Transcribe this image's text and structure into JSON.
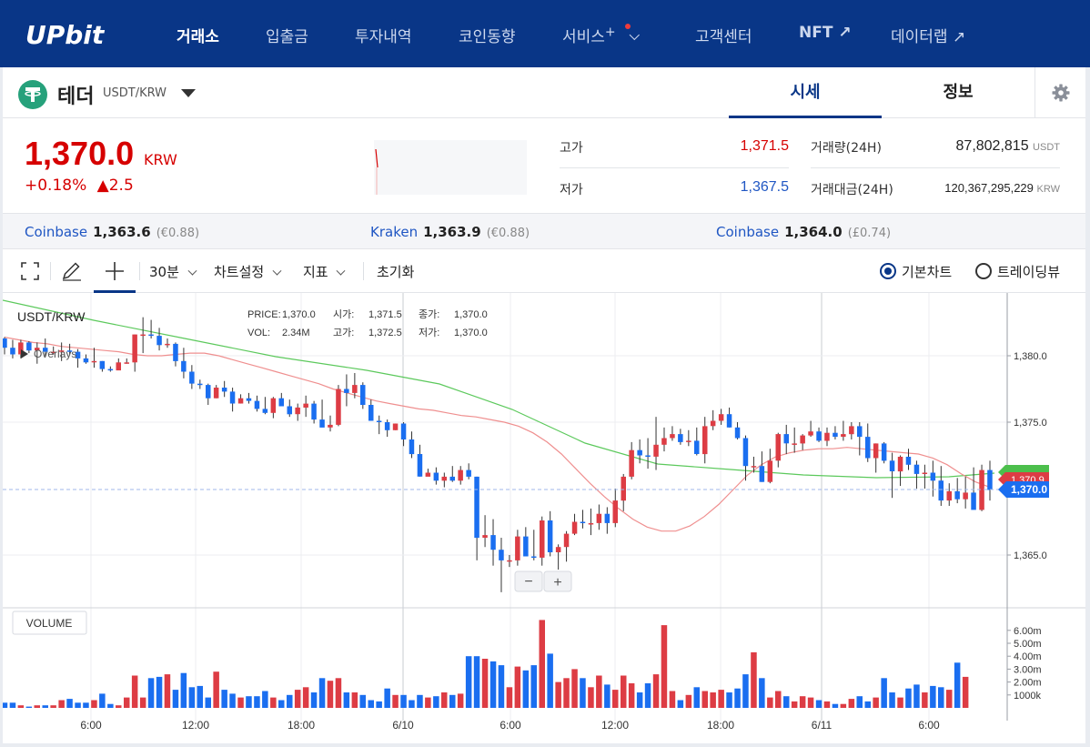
{
  "nav": {
    "logo": "UPbit",
    "items": [
      "거래소",
      "입출금",
      "투자내역",
      "코인동향",
      "서비스",
      "고객센터",
      "NFT ↗",
      "데이터랩 ↗"
    ],
    "service_suffix": "+"
  },
  "coin": {
    "name": "테더",
    "pair": "USDT/KRW",
    "tabs": [
      "시세",
      "정보"
    ],
    "icon": "tether-icon"
  },
  "price": {
    "current": "1,370.0",
    "unit": "KRW",
    "change_pct": "+0.18%",
    "change_abs": "▲2.5",
    "high_label": "고가",
    "high": "1,371.5",
    "low_label": "저가",
    "low": "1,367.5",
    "vol_label": "거래량(24H)",
    "vol": "87,802,815",
    "vol_unit": "USDT",
    "amt_label": "거래대금(24H)",
    "amt": "120,367,295,229",
    "amt_unit": "KRW"
  },
  "exchanges": [
    {
      "name": "Coinbase",
      "price": "1,363.6",
      "diff": "(€0.88)"
    },
    {
      "name": "Kraken",
      "price": "1,363.9",
      "diff": "(€0.88)"
    },
    {
      "name": "Coinbase",
      "price": "1,364.0",
      "diff": "(£0.74)"
    }
  ],
  "toolbar": {
    "interval": "30분",
    "chart_settings": "차트설정",
    "indicators": "지표",
    "reset": "초기화",
    "basic_chart": "기본차트",
    "tradingview": "트레이딩뷰"
  },
  "chart": {
    "symbol": "USDT/KRW",
    "overlays_label": "Overlays",
    "legend": {
      "price_label": "PRICE:",
      "price": "1,370.0",
      "open_label": "시가:",
      "open": "1,371.5",
      "close_label": "종가:",
      "close": "1,370.0",
      "vol_label": "VOL:",
      "vol": "2.34M",
      "high_label": "고가:",
      "high": "1,372.5",
      "low_label": "저가:",
      "low": "1,370.0"
    },
    "volume_label": "VOLUME",
    "zoom_out": "−",
    "zoom_in": "+",
    "current_price_tag": "1,370.0",
    "ma_tag": "1,370.9",
    "colors": {
      "up": "#dd3c44",
      "down": "#1a6ef0",
      "ma_short": "#ef8f8f",
      "ma_long": "#5cc95c"
    }
  },
  "chart_data": {
    "type": "candlestick",
    "y_ticks": [
      "1,380.0",
      "1,375.0",
      "1,365.0"
    ],
    "y_tick_values": [
      1380,
      1375,
      1365
    ],
    "x_ticks": [
      "6:00",
      "12:00",
      "18:00",
      "6/10",
      "6:00",
      "12:00",
      "18:00",
      "6/11",
      "6:00"
    ],
    "vol_ticks": [
      "6.00m",
      "5.00m",
      "4.00m",
      "3.00m",
      "2.00m",
      "1000k"
    ],
    "vol_tick_values": [
      6,
      5,
      4,
      3,
      2,
      1
    ],
    "candles_ohlc": [
      [
        1381.3,
        1381.4,
        1380.1,
        1380.6
      ],
      [
        1380.6,
        1381.2,
        1379.8,
        1380.1
      ],
      [
        1380.1,
        1381.2,
        1379.8,
        1381.0
      ],
      [
        1381.0,
        1381.1,
        1380.2,
        1380.4
      ],
      [
        1380.4,
        1381.0,
        1379.4,
        1380.6
      ],
      [
        1380.6,
        1381.3,
        1379.9,
        1380.3
      ],
      [
        1380.3,
        1380.7,
        1380.1,
        1380.3
      ],
      [
        1380.3,
        1381.0,
        1379.6,
        1380.4
      ],
      [
        1380.4,
        1380.9,
        1380.1,
        1380.3
      ],
      [
        1380.3,
        1380.5,
        1379.1,
        1379.8
      ],
      [
        1379.8,
        1380.1,
        1379.4,
        1379.5
      ],
      [
        1379.5,
        1380.6,
        1379.1,
        1379.6
      ],
      [
        1379.6,
        1379.6,
        1378.8,
        1379.0
      ],
      [
        1379.0,
        1379.2,
        1378.8,
        1378.9
      ],
      [
        1378.9,
        1379.8,
        1379.1,
        1379.5
      ],
      [
        1379.5,
        1379.8,
        1379.4,
        1379.5
      ],
      [
        1379.5,
        1381.6,
        1378.8,
        1381.6
      ],
      [
        1381.6,
        1382.9,
        1380.2,
        1381.6
      ],
      [
        1381.6,
        1382.7,
        1381.3,
        1381.5
      ],
      [
        1381.5,
        1382.1,
        1380.4,
        1380.8
      ],
      [
        1380.8,
        1381.3,
        1380.6,
        1380.9
      ],
      [
        1380.9,
        1381.0,
        1379.2,
        1379.6
      ],
      [
        1379.6,
        1380.6,
        1378.3,
        1378.8
      ],
      [
        1378.8,
        1379.3,
        1377.5,
        1377.9
      ],
      [
        1377.9,
        1378.2,
        1377.5,
        1377.8
      ],
      [
        1377.8,
        1377.9,
        1376.3,
        1376.8
      ],
      [
        1376.8,
        1377.8,
        1376.8,
        1377.6
      ],
      [
        1377.6,
        1378.1,
        1376.9,
        1377.3
      ],
      [
        1377.3,
        1377.6,
        1375.8,
        1376.4
      ],
      [
        1376.4,
        1377.1,
        1376.4,
        1376.8
      ],
      [
        1376.8,
        1377.2,
        1376.4,
        1376.6
      ],
      [
        1376.6,
        1377.0,
        1375.8,
        1376.0
      ],
      [
        1376.0,
        1376.9,
        1375.6,
        1375.7
      ],
      [
        1375.7,
        1376.9,
        1375.3,
        1376.8
      ],
      [
        1376.8,
        1377.2,
        1376.3,
        1376.2
      ],
      [
        1376.2,
        1376.7,
        1375.4,
        1375.6
      ],
      [
        1375.6,
        1376.4,
        1375.1,
        1376.1
      ],
      [
        1376.1,
        1377.0,
        1375.4,
        1376.4
      ],
      [
        1376.4,
        1376.6,
        1374.9,
        1375.2
      ],
      [
        1375.2,
        1376.7,
        1374.7,
        1374.6
      ],
      [
        1374.6,
        1375.5,
        1374.3,
        1374.8
      ],
      [
        1374.8,
        1377.8,
        1374.7,
        1377.5
      ],
      [
        1377.5,
        1378.6,
        1376.2,
        1377.2
      ],
      [
        1377.2,
        1378.7,
        1376.8,
        1377.8
      ],
      [
        1377.8,
        1378.0,
        1376.0,
        1376.3
      ],
      [
        1376.3,
        1376.7,
        1375.1,
        1375.1
      ],
      [
        1375.1,
        1375.5,
        1374.1,
        1375.0
      ],
      [
        1375.0,
        1375.2,
        1373.9,
        1374.4
      ],
      [
        1374.4,
        1374.9,
        1374.4,
        1374.9
      ],
      [
        1374.9,
        1375.0,
        1373.2,
        1373.7
      ],
      [
        1373.7,
        1374.3,
        1372.3,
        1372.6
      ],
      [
        1372.6,
        1373.3,
        1370.9,
        1370.9
      ],
      [
        1370.9,
        1371.5,
        1371.1,
        1371.2
      ],
      [
        1371.2,
        1371.6,
        1370.3,
        1370.6
      ],
      [
        1370.6,
        1371.2,
        1370.1,
        1370.9
      ],
      [
        1370.9,
        1371.7,
        1370.5,
        1370.6
      ],
      [
        1370.6,
        1371.7,
        1370.3,
        1371.4
      ],
      [
        1371.4,
        1371.9,
        1370.7,
        1370.9
      ],
      [
        1370.9,
        1370.9,
        1364.6,
        1366.3
      ],
      [
        1366.3,
        1368.0,
        1365.6,
        1366.5
      ],
      [
        1366.5,
        1367.7,
        1364.2,
        1365.4
      ],
      [
        1365.4,
        1366.3,
        1362.2,
        1364.6
      ],
      [
        1364.6,
        1365.0,
        1364.1,
        1364.6
      ],
      [
        1364.6,
        1366.9,
        1364.2,
        1366.4
      ],
      [
        1366.4,
        1367.1,
        1365.1,
        1364.9
      ],
      [
        1364.9,
        1366.9,
        1364.6,
        1364.8
      ],
      [
        1364.8,
        1367.9,
        1364.2,
        1367.6
      ],
      [
        1367.6,
        1368.3,
        1364.9,
        1365.2
      ],
      [
        1365.2,
        1365.8,
        1363.9,
        1365.6
      ],
      [
        1365.6,
        1366.8,
        1364.5,
        1366.6
      ],
      [
        1366.6,
        1368.1,
        1366.5,
        1367.5
      ],
      [
        1367.5,
        1368.4,
        1367.0,
        1367.4
      ],
      [
        1367.4,
        1368.5,
        1366.5,
        1367.4
      ],
      [
        1367.4,
        1368.8,
        1366.9,
        1368.1
      ],
      [
        1368.1,
        1368.6,
        1366.6,
        1367.4
      ],
      [
        1367.4,
        1370.0,
        1367.1,
        1369.1
      ],
      [
        1369.1,
        1371.1,
        1368.3,
        1370.9
      ],
      [
        1370.9,
        1373.5,
        1370.7,
        1372.9
      ],
      [
        1372.9,
        1373.7,
        1371.9,
        1372.5
      ],
      [
        1372.5,
        1373.8,
        1371.5,
        1372.4
      ],
      [
        1372.4,
        1375.4,
        1371.4,
        1373.3
      ],
      [
        1373.3,
        1374.6,
        1372.8,
        1373.8
      ],
      [
        1373.8,
        1374.7,
        1373.6,
        1374.1
      ],
      [
        1374.1,
        1374.5,
        1373.3,
        1373.5
      ],
      [
        1373.5,
        1374.4,
        1373.2,
        1373.6
      ],
      [
        1373.6,
        1374.6,
        1372.5,
        1372.6
      ],
      [
        1372.6,
        1375.4,
        1371.9,
        1374.7
      ],
      [
        1374.7,
        1375.9,
        1374.4,
        1375.1
      ],
      [
        1375.1,
        1376.0,
        1374.8,
        1375.6
      ],
      [
        1375.6,
        1376.1,
        1374.6,
        1374.6
      ],
      [
        1374.6,
        1375.0,
        1373.7,
        1373.8
      ],
      [
        1373.8,
        1374.0,
        1370.6,
        1371.7
      ],
      [
        1371.7,
        1372.4,
        1371.2,
        1371.7
      ],
      [
        1371.7,
        1372.8,
        1370.5,
        1370.5
      ],
      [
        1370.5,
        1373.0,
        1370.4,
        1372.1
      ],
      [
        1372.1,
        1374.2,
        1371.6,
        1374.1
      ],
      [
        1374.1,
        1374.8,
        1372.6,
        1373.4
      ],
      [
        1373.4,
        1374.6,
        1372.7,
        1373.4
      ],
      [
        1373.4,
        1374.1,
        1372.9,
        1374.0
      ],
      [
        1374.0,
        1375.1,
        1373.9,
        1374.3
      ],
      [
        1374.3,
        1374.6,
        1373.5,
        1373.6
      ],
      [
        1373.6,
        1374.6,
        1373.2,
        1374.2
      ],
      [
        1374.2,
        1374.7,
        1373.7,
        1373.9
      ],
      [
        1373.9,
        1375.1,
        1373.6,
        1374.1
      ],
      [
        1374.1,
        1375.0,
        1373.7,
        1374.7
      ],
      [
        1374.7,
        1375.0,
        1372.5,
        1373.9
      ],
      [
        1373.9,
        1374.9,
        1372.0,
        1372.3
      ],
      [
        1372.3,
        1373.4,
        1371.2,
        1373.4
      ],
      [
        1373.4,
        1373.5,
        1371.9,
        1372.1
      ],
      [
        1372.1,
        1372.7,
        1369.3,
        1371.3
      ],
      [
        1371.3,
        1372.5,
        1370.2,
        1372.4
      ],
      [
        1372.4,
        1373.0,
        1371.4,
        1371.8
      ],
      [
        1371.8,
        1372.1,
        1370.0,
        1371.1
      ],
      [
        1371.1,
        1371.8,
        1370.0,
        1371.2
      ],
      [
        1371.2,
        1372.1,
        1369.4,
        1370.6
      ],
      [
        1370.6,
        1371.7,
        1368.7,
        1369.1
      ],
      [
        1369.1,
        1370.4,
        1368.7,
        1369.8
      ],
      [
        1369.8,
        1370.8,
        1368.9,
        1369.2
      ],
      [
        1369.2,
        1370.9,
        1368.5,
        1369.7
      ],
      [
        1369.7,
        1371.6,
        1368.7,
        1368.4
      ],
      [
        1368.4,
        1371.8,
        1368.3,
        1371.4
      ],
      [
        1371.4,
        1372.1,
        1369.1,
        1369.9
      ]
    ],
    "volumes": [
      0.4,
      0.4,
      0.2,
      0.1,
      0.2,
      0.2,
      0.2,
      0.6,
      0.7,
      0.4,
      0.4,
      0.6,
      1.1,
      0.3,
      0.2,
      0.8,
      2.5,
      0.8,
      2.3,
      2.4,
      2.6,
      1.4,
      2.7,
      1.6,
      1.7,
      0.8,
      2.8,
      1.4,
      1.1,
      0.8,
      0.9,
      0.9,
      1.3,
      0.8,
      0.6,
      1.0,
      1.4,
      1.6,
      1.2,
      2.3,
      2.1,
      2.3,
      1.2,
      1.2,
      1.0,
      0.6,
      0.5,
      1.5,
      1.0,
      1.0,
      0.6,
      1.0,
      0.8,
      0.9,
      1.2,
      1.0,
      1.1,
      4.0,
      4.0,
      3.8,
      3.6,
      3.3,
      1.6,
      3.2,
      2.9,
      3.3,
      6.8,
      4.2,
      2.0,
      2.3,
      3.0,
      2.3,
      1.6,
      2.5,
      1.8,
      1.4,
      2.5,
      1.9,
      1.2,
      1.9,
      2.6,
      6.4,
      1.3,
      0.6,
      1.0,
      1.6,
      1.3,
      1.2,
      1.4,
      1.2,
      1.5,
      2.6,
      4.3,
      2.3,
      0.8,
      1.3,
      0.9,
      0.5,
      0.9,
      0.8,
      0.6,
      0.5,
      0.3,
      0.3,
      0.7,
      0.9,
      0.5,
      0.8,
      2.3,
      1.2,
      0.8,
      1.5,
      1.8,
      1.2,
      1.7,
      1.6,
      1.4,
      3.5,
      2.4
    ],
    "ma_short": [
      1381.4,
      1381.2,
      1381.0,
      1380.9,
      1380.7,
      1380.6,
      1380.5,
      1380.4,
      1380.3,
      1380.1,
      1380.0,
      1380.0,
      1380.1,
      1380.2,
      1380.2,
      1380.0,
      1379.7,
      1379.4,
      1379.1,
      1378.8,
      1378.5,
      1378.2,
      1377.9,
      1377.5,
      1377.2,
      1376.9,
      1376.6,
      1376.4,
      1376.2,
      1376.0,
      1375.9,
      1375.7,
      1375.5,
      1375.4,
      1375.2,
      1375.0,
      1374.7,
      1374.2,
      1373.5,
      1372.6,
      1371.5,
      1370.4,
      1369.4,
      1368.5,
      1367.7,
      1367.1,
      1366.8,
      1366.8,
      1367.2,
      1367.9,
      1368.8,
      1369.9,
      1371.0,
      1371.8,
      1372.4,
      1372.7,
      1372.9,
      1373.0,
      1373.0,
      1373.1,
      1373.0,
      1372.9,
      1372.8,
      1372.7,
      1372.6,
      1372.3,
      1371.8,
      1371.1,
      1370.5,
      1370.1
    ]
  }
}
